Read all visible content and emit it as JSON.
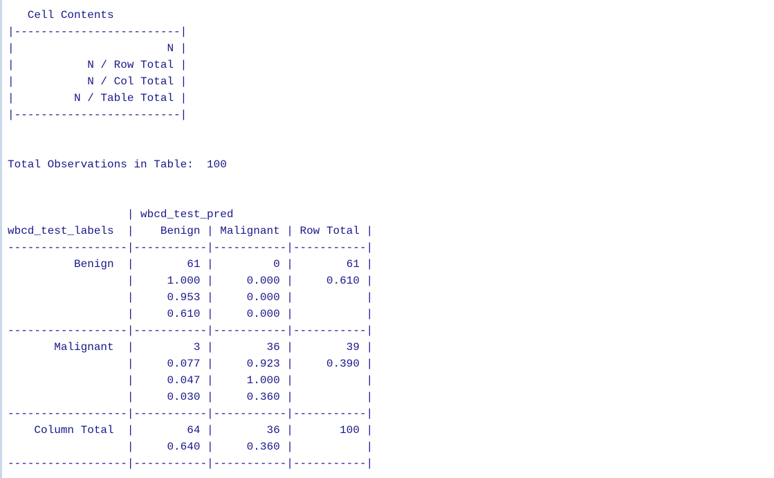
{
  "console": {
    "lines": [
      "   Cell Contents",
      "|-------------------------|",
      "|                       N |",
      "|           N / Row Total |",
      "|           N / Col Total |",
      "|         N / Table Total |",
      "|-------------------------|",
      "",
      "",
      "Total Observations in Table:  100",
      "",
      "",
      "                  | wbcd_test_pred",
      "wbcd_test_labels  |    Benign | Malignant | Row Total |",
      "------------------|-----------|-----------|-----------|",
      "          Benign  |        61 |         0 |        61 |",
      "                  |     1.000 |     0.000 |     0.610 |",
      "                  |     0.953 |     0.000 |           |",
      "                  |     0.610 |     0.000 |           |",
      "------------------|-----------|-----------|-----------|",
      "       Malignant  |         3 |        36 |        39 |",
      "                  |     0.077 |     0.923 |     0.390 |",
      "                  |     0.047 |     1.000 |           |",
      "                  |     0.030 |     0.360 |           |",
      "------------------|-----------|-----------|-----------|",
      "    Column Total  |        64 |        36 |       100 |",
      "                  |     0.640 |     0.360 |           |",
      "------------------|-----------|-----------|-----------|"
    ]
  }
}
